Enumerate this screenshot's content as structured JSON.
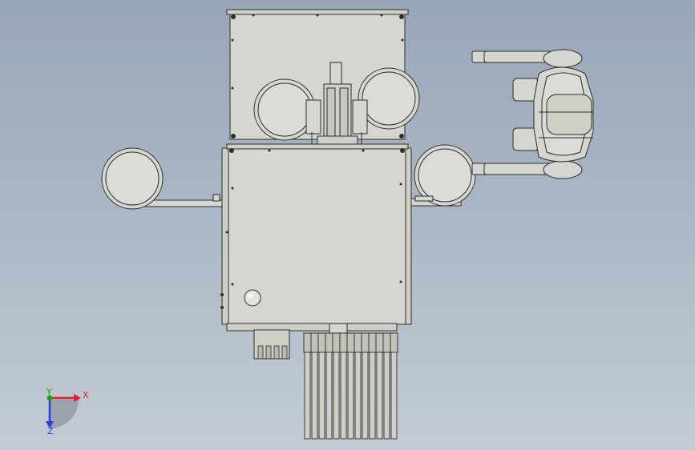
{
  "triad": {
    "x_label": "X",
    "y_label": "Y",
    "z_label": "Z",
    "colors": {
      "x": "#e0202a",
      "y": "#1aa31a",
      "z": "#2a3fd6"
    }
  },
  "palette": {
    "metal": "#d6d6d0",
    "metal_light": "#e4e4de",
    "outline": "#2c2c2c",
    "shadow": "#b9b9b2"
  }
}
